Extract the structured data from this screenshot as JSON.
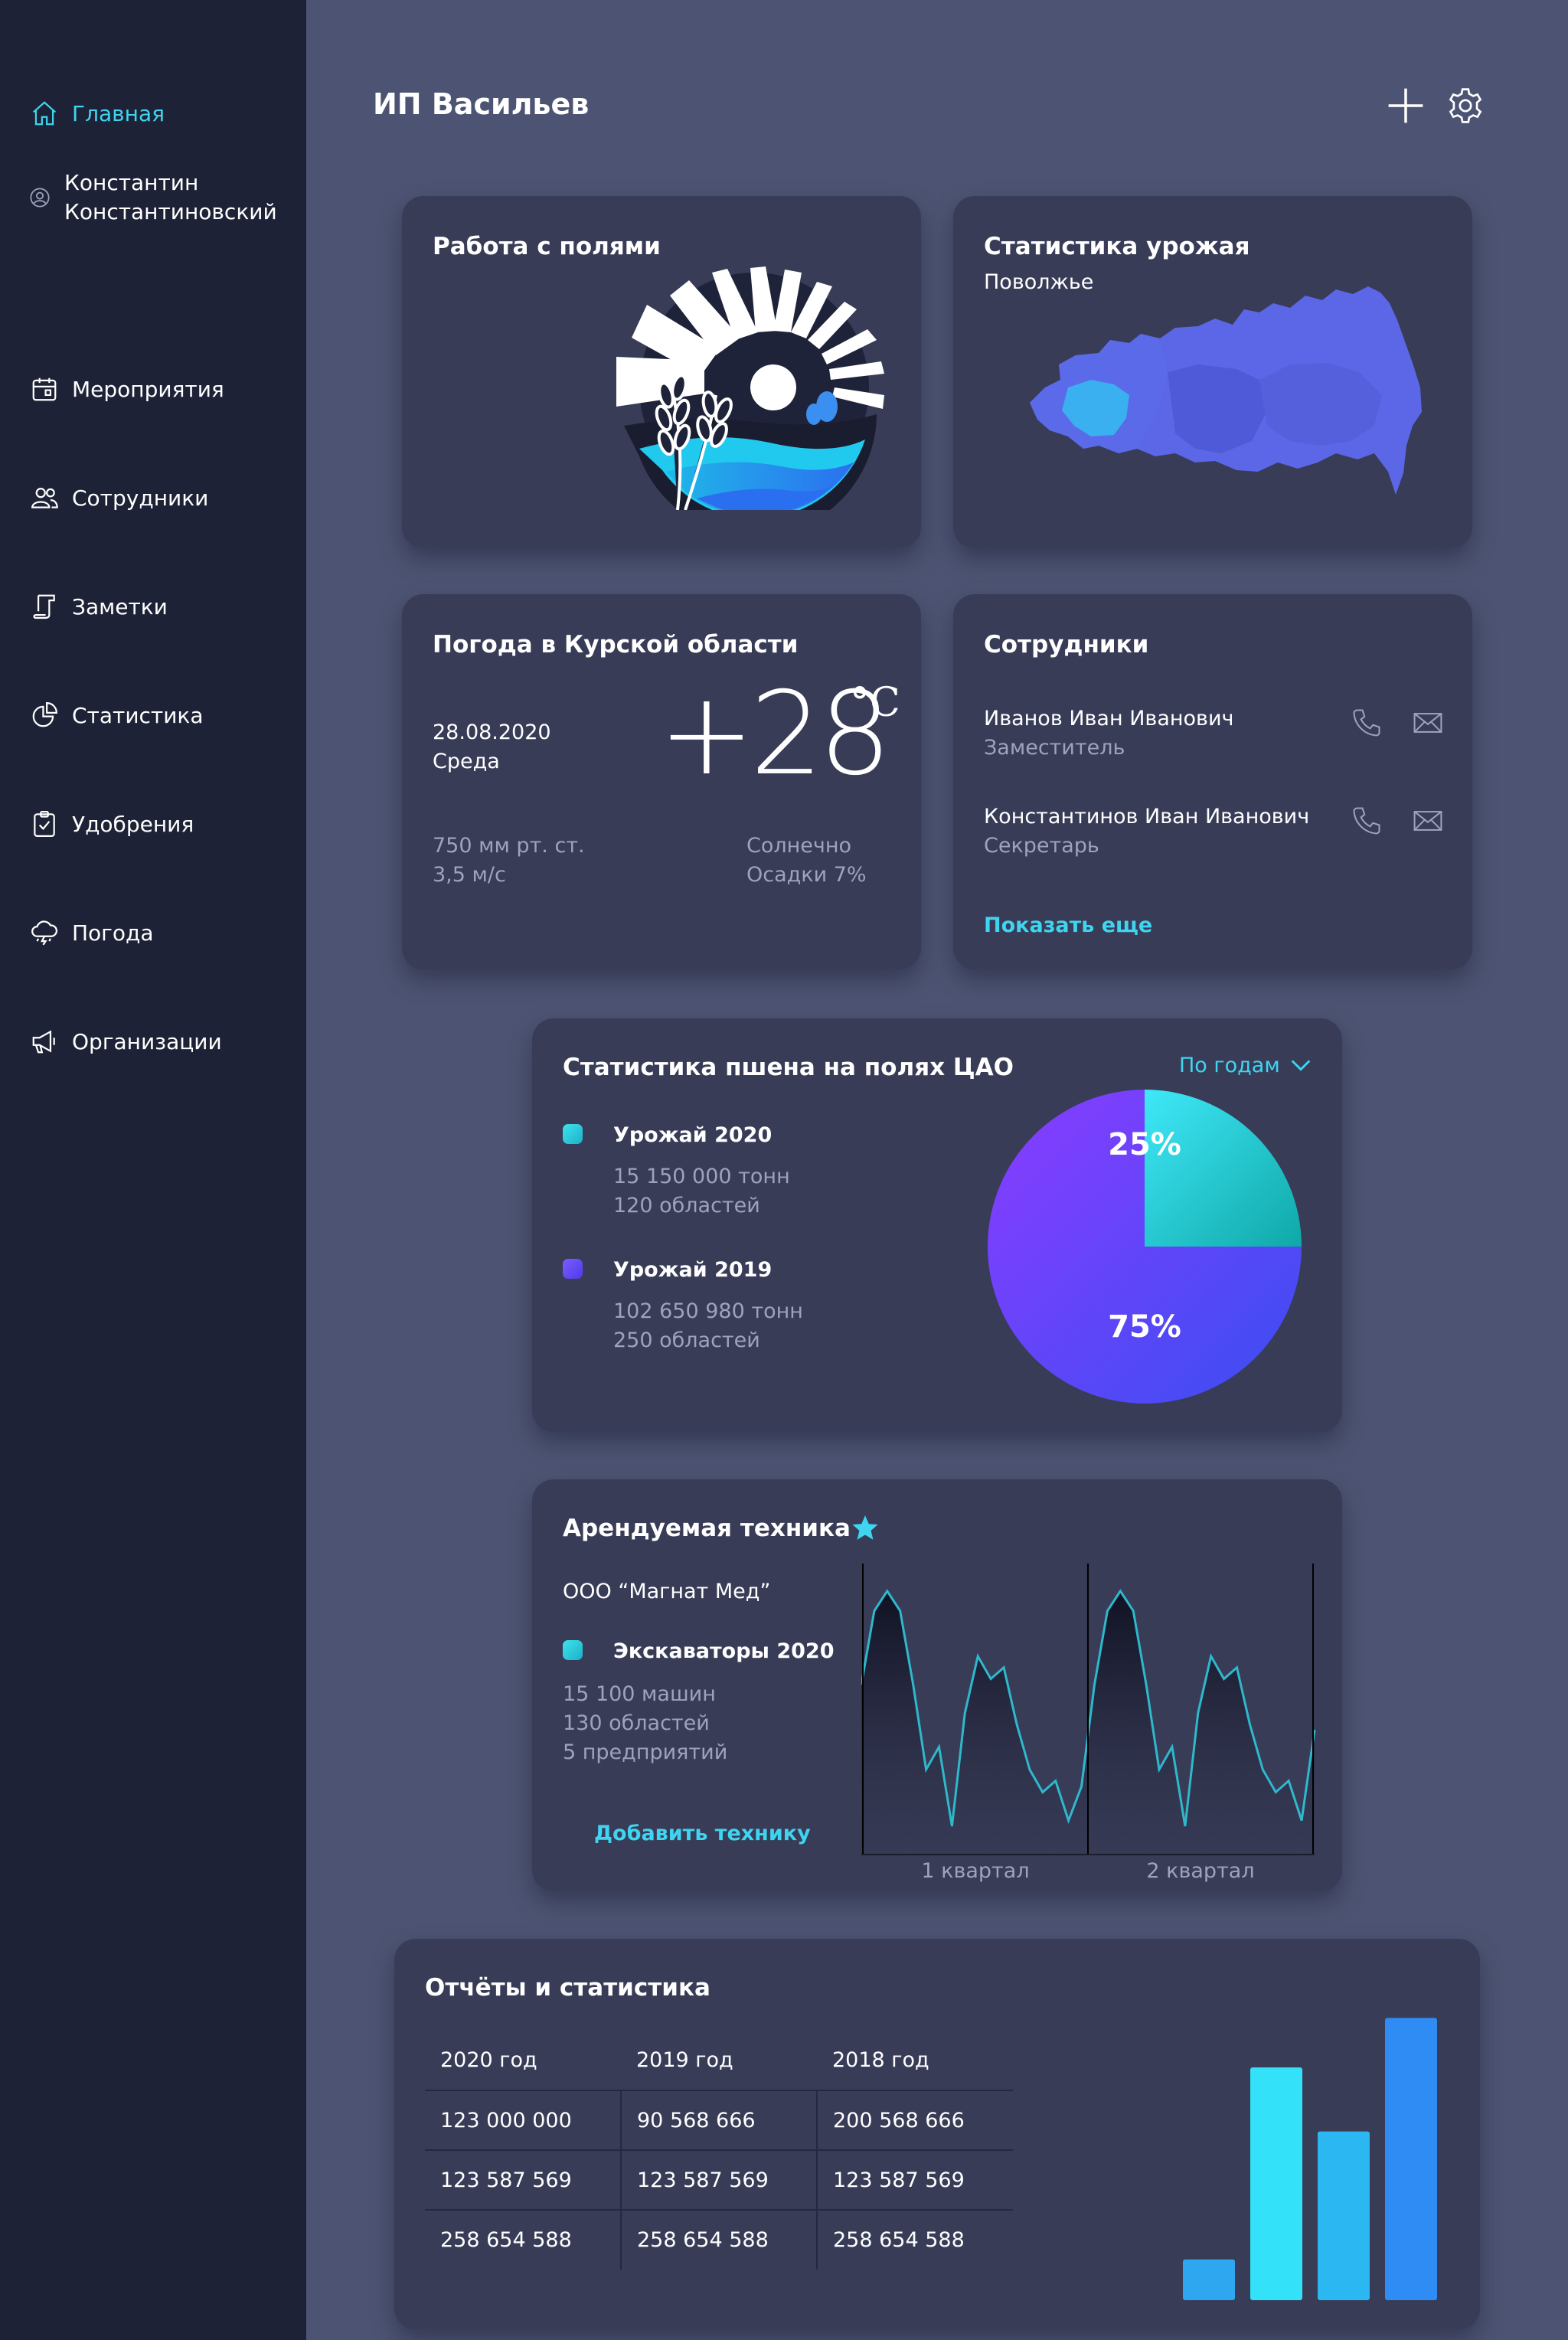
{
  "colors": {
    "accent": "#3fd5f0",
    "sidebar_bg": "#1e2236",
    "page_bg": "#4d5473",
    "card_bg": "#383c57",
    "harvest_2020": "#2fd6e6",
    "harvest_2019": "#6a4cf7"
  },
  "sidebar": {
    "home": {
      "label": "Главная",
      "icon": "home-icon"
    },
    "user": {
      "line1": "Константин",
      "line2": "Константиновский",
      "icon": "user-icon"
    },
    "items": [
      {
        "label": "Мероприятия",
        "icon": "calendar-icon"
      },
      {
        "label": "Сотрудники",
        "icon": "users-icon"
      },
      {
        "label": "Заметки",
        "icon": "notes-icon"
      },
      {
        "label": "Статистика",
        "icon": "pie-chart-icon"
      },
      {
        "label": "Удобрения",
        "icon": "clipboard-check-icon"
      },
      {
        "label": "Погода",
        "icon": "cloud-storm-icon"
      },
      {
        "label": "Организации",
        "icon": "megaphone-icon"
      }
    ]
  },
  "header": {
    "title": "ИП Васильев",
    "add_icon": "plus-icon",
    "settings_icon": "gear-icon"
  },
  "fields_card": {
    "title": "Работа с полями",
    "logo": "wheat-sun-logo"
  },
  "harvest_card": {
    "title": "Статистика урожая",
    "subtitle": "Поволжье",
    "map": "russia-map"
  },
  "weather_card": {
    "title": "Погода в Курской области",
    "date": "28.08.2020",
    "weekday": "Среда",
    "temperature": "+28",
    "unit": "°C",
    "pressure": "750 мм рт. ст.",
    "wind": "3,5 м/с",
    "condition": "Солнечно",
    "precipitation": "Осадки 7%"
  },
  "employees_card": {
    "title": "Сотрудники",
    "employees": [
      {
        "name": "Иванов Иван Иванович",
        "role": "Заместитель"
      },
      {
        "name": "Константинов Иван Иванович",
        "role": "Секретарь"
      }
    ],
    "show_more": "Показать еще"
  },
  "wheat_card": {
    "title": "Статистика пшена на полях ЦАО",
    "filter": "По годам",
    "legend": [
      {
        "label": "Урожай 2020",
        "tons": "15 150 000 тонн",
        "regions": "120 областей"
      },
      {
        "label": "Урожай 2019",
        "tons": "102 650 980 тонн",
        "regions": "250 областей"
      }
    ]
  },
  "equipment_card": {
    "title": "Арендуемая техника",
    "company": "ООО “Магнат Мед”",
    "legend_label": "Экскаваторы 2020",
    "machines": "15 100 машин",
    "regions": "130 областей",
    "companies": "5 предприятий",
    "add_link": "Добавить технику"
  },
  "reports_card": {
    "title": "Отчёты и статистика",
    "headers": [
      "2020 год",
      "2019 год",
      "2018 год"
    ],
    "rows": [
      [
        "123 000 000",
        "90 568 666",
        "200 568 666"
      ],
      [
        "123 587 569",
        "123 587 569",
        "123 587 569"
      ],
      [
        "258 654 588",
        "258 654 588",
        "258 654 588"
      ]
    ]
  },
  "chart_data": [
    {
      "type": "pie",
      "title": "Статистика пшена на полях ЦАО",
      "labels": [
        "Урожай 2020",
        "Урожай 2019"
      ],
      "values": [
        25,
        75
      ],
      "value_labels": [
        "25%",
        "75%"
      ],
      "colors": [
        "#2fd6e6",
        "#6a4cf7"
      ]
    },
    {
      "type": "line",
      "title": "Арендуемая техника",
      "categories": [
        "1 квартал",
        "2 квартал"
      ],
      "series": [
        {
          "name": "Экскаваторы 2020",
          "values": [
            60,
            86,
            93,
            86,
            60,
            30,
            38,
            10,
            50,
            70,
            62,
            66,
            46,
            30,
            22,
            26,
            12,
            24,
            60,
            86,
            93,
            86,
            60,
            30,
            38,
            10,
            50,
            70,
            62,
            66,
            46,
            30,
            22,
            26,
            12,
            44
          ]
        }
      ],
      "grid": false
    },
    {
      "type": "bar",
      "title": "Отчёты и статистика",
      "values": [
        14,
        80,
        58,
        97
      ],
      "ylim": [
        0,
        100
      ]
    }
  ]
}
